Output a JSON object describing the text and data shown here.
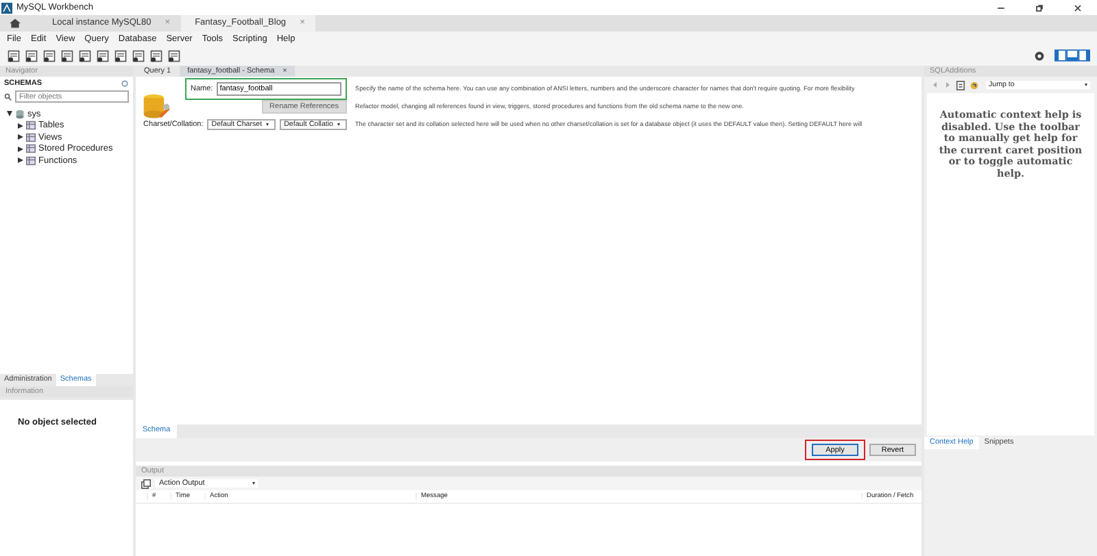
{
  "window": {
    "title": "MySQL Workbench"
  },
  "connection_tabs": [
    {
      "label": "Local instance MySQL80",
      "close": "×",
      "selected": false
    },
    {
      "label": "Fantasy_Football_Blog",
      "close": "×",
      "selected": true
    }
  ],
  "menu": [
    "File",
    "Edit",
    "View",
    "Query",
    "Database",
    "Server",
    "Tools",
    "Scripting",
    "Help"
  ],
  "navigator": {
    "title": "Navigator",
    "schemas_label": "SCHEMAS",
    "filter": {
      "placeholder": "Filter objects"
    },
    "tree": [
      {
        "label": "sys",
        "expanded": true,
        "children": [
          {
            "label": "Tables",
            "expanded": false
          },
          {
            "label": "Views",
            "expanded": false
          },
          {
            "label": "Stored Procedures",
            "expanded": false
          },
          {
            "label": "Functions",
            "expanded": false
          }
        ]
      }
    ],
    "tabs": [
      {
        "label": "Administration",
        "selected": false
      },
      {
        "label": "Schemas",
        "selected": true
      }
    ]
  },
  "information": {
    "title": "Information",
    "message": "No object selected"
  },
  "editor_tabs": [
    {
      "label": "Query 1",
      "selected": false
    },
    {
      "label": "fantasy_football - Schema",
      "close": "×",
      "selected": true
    }
  ],
  "schema_form": {
    "name_label": "Name:",
    "name_value": "fantasy_football",
    "name_highlighted": true,
    "name_help": "Specify the name of the schema here. You can use any combination of ANSI letters, numbers and the underscore character for names that don't require quoting. For more flexibility",
    "rename_button": "Rename References",
    "rename_help": "Refactor model, changing all references found in view, triggers, stored procedures and functions from the old schema name to the new one.",
    "charset_label": "Charset/Collation:",
    "charset": "Default Charset",
    "collation": "Default Collatio",
    "charset_help": "The character set and its collation selected here will be used when no other charset/collation is set for a database object (it uses the DEFAULT value then). Setting DEFAULT here will"
  },
  "bottom_tabs": [
    {
      "label": "Schema",
      "selected": true
    }
  ],
  "buttons": [
    {
      "label": "Apply",
      "highlighted": true
    },
    {
      "label": "Revert",
      "highlighted": false
    }
  ],
  "output": {
    "title": "Output",
    "selector": "Action Output",
    "columns": [
      "#",
      "Time",
      "Action",
      "Message",
      "Duration / Fetch"
    ]
  },
  "sql_additions": {
    "title": "SQLAdditions",
    "jump_to": "Jump to",
    "help_text": "Automatic context help is disabled. Use the toolbar to manually get help for the current caret position or to toggle automatic help.",
    "tabs": [
      {
        "label": "Context Help",
        "selected": true
      },
      {
        "label": "Snippets",
        "selected": false
      }
    ]
  }
}
